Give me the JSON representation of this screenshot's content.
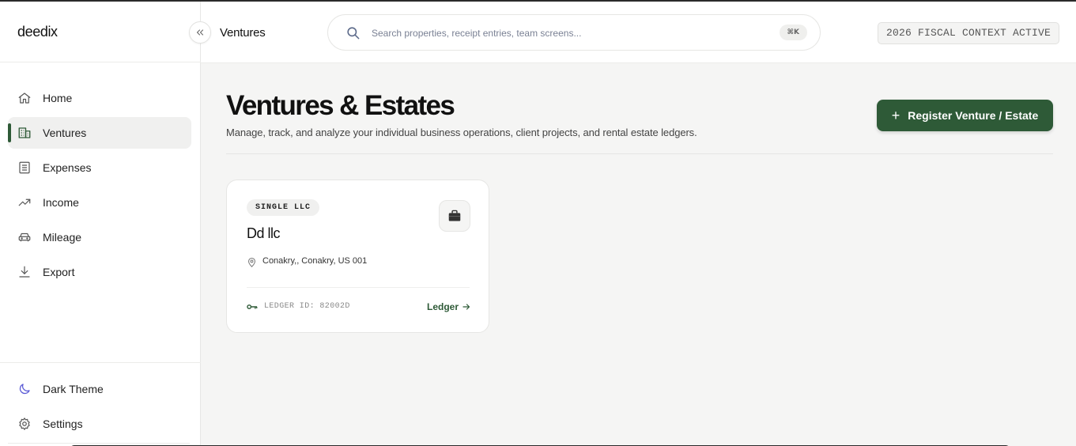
{
  "app": {
    "brand": "deedix"
  },
  "sidebar": {
    "items": [
      {
        "label": "Home",
        "icon": "home-icon"
      },
      {
        "label": "Ventures",
        "icon": "building-icon",
        "active": true
      },
      {
        "label": "Expenses",
        "icon": "receipt-icon"
      },
      {
        "label": "Income",
        "icon": "trending-up-icon"
      },
      {
        "label": "Mileage",
        "icon": "car-icon"
      },
      {
        "label": "Export",
        "icon": "download-icon"
      }
    ],
    "bottom": [
      {
        "label": "Dark Theme",
        "icon": "moon-icon"
      },
      {
        "label": "Settings",
        "icon": "gear-icon"
      }
    ],
    "collapse_icon": "chevrons-left-icon"
  },
  "header": {
    "breadcrumb": "Ventures",
    "search": {
      "placeholder": "Search properties, receipt entries, team screens...",
      "value": "",
      "shortcut": "⌘K"
    },
    "fiscal_badge": "2026 FISCAL CONTEXT ACTIVE"
  },
  "main": {
    "title": "Ventures & Estates",
    "subtitle": "Manage, track, and analyze your individual business operations, client projects, and rental estate ledgers.",
    "register_button": {
      "label": "Register Venture / Estate",
      "icon": "plus-icon"
    },
    "ventures": [
      {
        "type": "SINGLE LLC",
        "name": "Dd llc",
        "location": "Conakry,, Conakry, US 001",
        "ledger_id": "LEDGER ID: 82002D",
        "ledger_link": "Ledger"
      }
    ]
  },
  "colors": {
    "accent": "#2e5a37",
    "moon": "#5b5bd6"
  }
}
